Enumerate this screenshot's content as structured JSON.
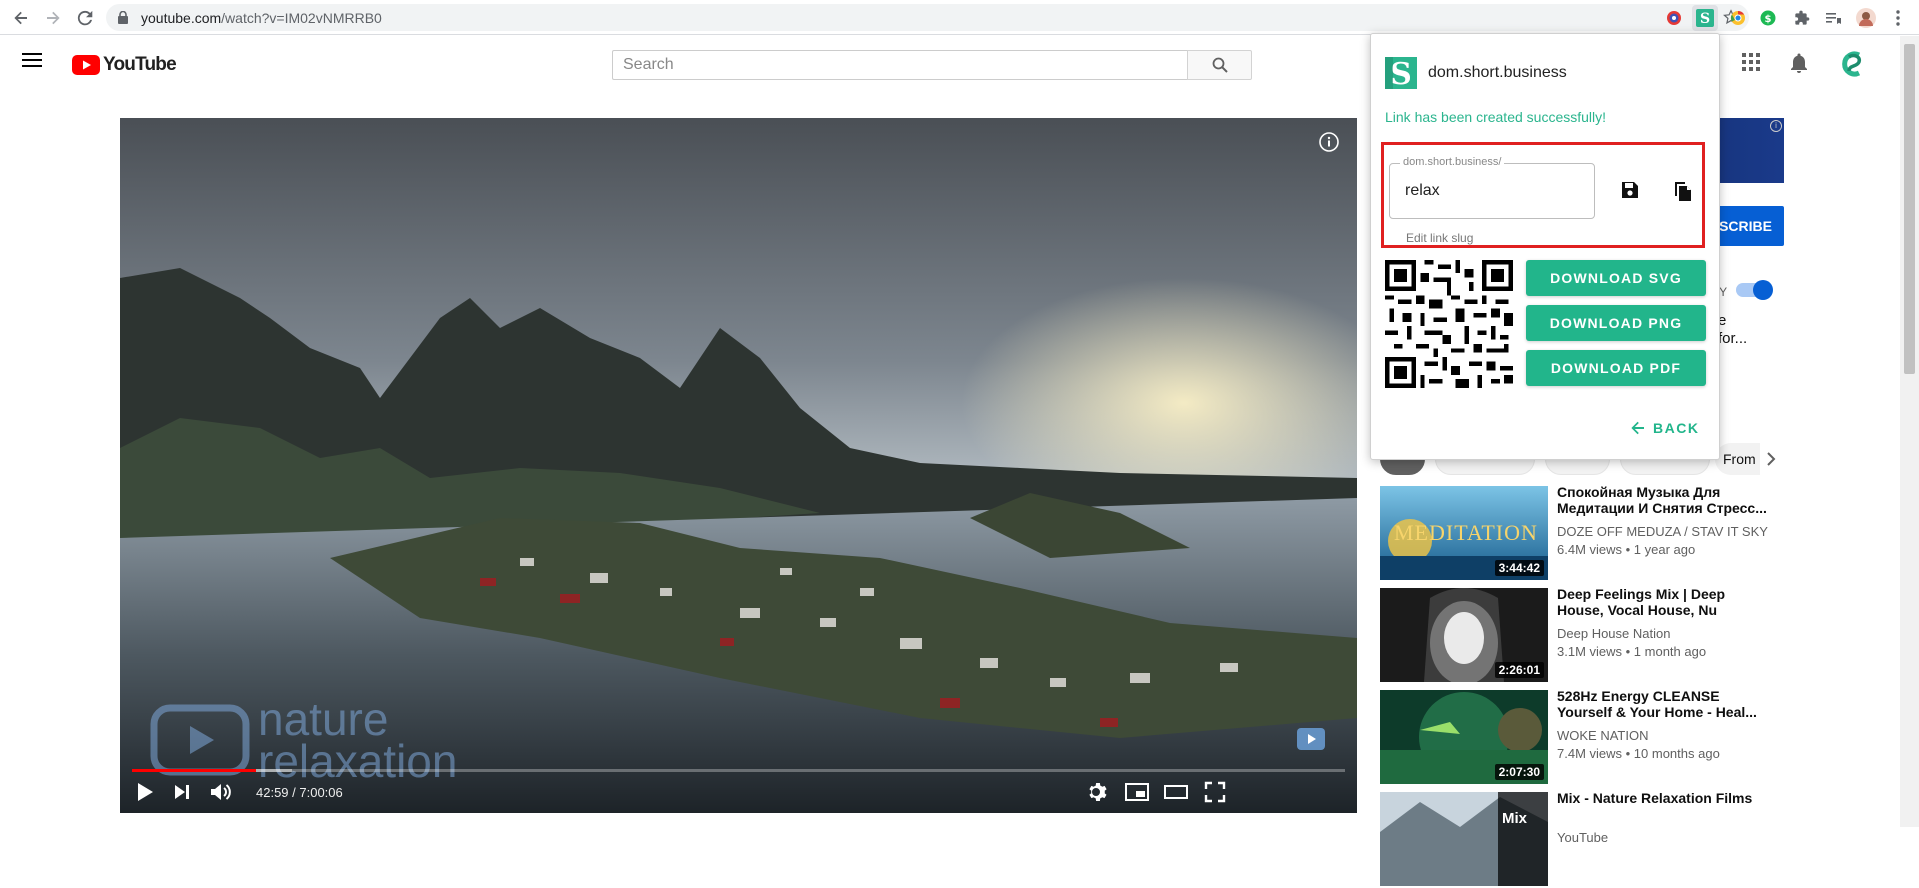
{
  "browser": {
    "url_host": "youtube.com",
    "url_path": "/watch?v=IM02vNMRRB0"
  },
  "youtube": {
    "logo_text": "YouTube",
    "search_placeholder": "Search"
  },
  "player": {
    "time": "42:59 / 7:00:06",
    "progress": 0.102,
    "watermark_line1": "nature",
    "watermark_line2": "relaxation"
  },
  "sidebar": {
    "subscribe_label": "SCRIBE",
    "autoplay_label": "AY",
    "upnext_fragment_1": "e",
    "upnext_fragment_2": "for...",
    "chip_from": "From",
    "recommendations": [
      {
        "title": "Спокойная Музыка Для Медитации И Снятия Стресс...",
        "channel": "DOZE OFF MEDUZA / STAV IT SKY",
        "meta": "6.4M views • 1 year ago",
        "duration": "3:44:42",
        "thumb_text": "MEDITATION"
      },
      {
        "title": "Deep Feelings Mix | Deep House, Vocal House, Nu Disco...",
        "channel": "Deep House Nation",
        "meta": "3.1M views • 1 month ago",
        "duration": "2:26:01"
      },
      {
        "title": "528Hz Energy CLEANSE Yourself & Your Home - Heal...",
        "channel": "WOKE NATION",
        "meta": "7.4M views • 10 months ago",
        "duration": "2:07:30"
      },
      {
        "title": "Mix - Nature Relaxation Films",
        "channel": "YouTube",
        "meta": "",
        "duration": "",
        "thumb_text": "Mix"
      }
    ]
  },
  "popup": {
    "title": "dom.short.business",
    "success_message": "Link has been created successfully!",
    "slug_domain_label": "dom.short.business/",
    "slug_value": "relax",
    "slug_helper": "Edit link slug",
    "download_svg": "DOWNLOAD SVG",
    "download_png": "DOWNLOAD PNG",
    "download_pdf": "DOWNLOAD PDF",
    "back_label": "BACK"
  },
  "colors": {
    "brand_green": "#22b58b",
    "highlight_red": "#e02020",
    "youtube_red": "#ff0000",
    "subscribe_blue": "#065fd4"
  }
}
